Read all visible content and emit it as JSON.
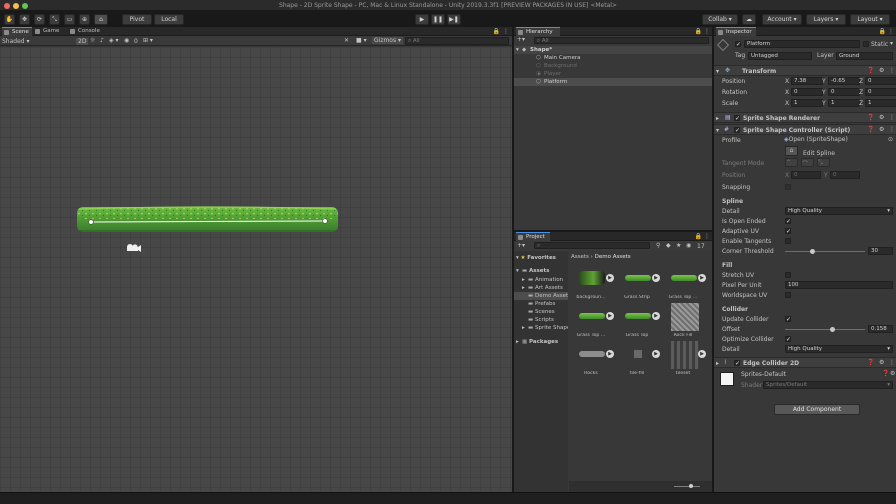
{
  "window": {
    "title": "Shape - 2D Sprite Shape - PC, Mac & Linux Standalone - Unity 2019.3.3f1 [PREVIEW PACKAGES IN USE] <Metal>"
  },
  "toolbar": {
    "pivot": "Pivot",
    "local": "Local",
    "collab": "Collab",
    "account": "Account",
    "layers": "Layers",
    "layout": "Layout"
  },
  "scene": {
    "tabs": [
      "Scene",
      "Game",
      "Console"
    ],
    "shading": "Shaded",
    "mode_2d": "2D",
    "fx_count": "0",
    "gizmos": "Gizmos",
    "search": "All"
  },
  "hierarchy": {
    "tab": "Hierarchy",
    "search": "All",
    "items": [
      {
        "label": "Shape*",
        "depth": 0,
        "active": true,
        "selected": false,
        "root": true
      },
      {
        "label": "Main Camera",
        "depth": 1,
        "active": true,
        "selected": false
      },
      {
        "label": "Background",
        "depth": 1,
        "active": false,
        "selected": false
      },
      {
        "label": "Player",
        "depth": 1,
        "active": false,
        "selected": false
      },
      {
        "label": "Platform",
        "depth": 1,
        "active": true,
        "selected": true
      }
    ]
  },
  "project": {
    "tab": "Project",
    "breadcrumb_root": "Assets",
    "breadcrumb_leaf": "Demo Assets",
    "count": "17",
    "favorites": "Favorites",
    "tree": [
      {
        "label": "Assets",
        "depth": 0
      },
      {
        "label": "Animation",
        "depth": 1
      },
      {
        "label": "Art Assets",
        "depth": 1
      },
      {
        "label": "Demo Assets",
        "depth": 1
      },
      {
        "label": "Prefabs",
        "depth": 1
      },
      {
        "label": "Scenes",
        "depth": 1
      },
      {
        "label": "Scripts",
        "depth": 1
      },
      {
        "label": "Sprite Shape",
        "depth": 1
      },
      {
        "label": "Packages",
        "depth": 0
      }
    ],
    "assets": [
      {
        "label": "backgroun..."
      },
      {
        "label": "Grass Strip"
      },
      {
        "label": "Grass Top ..."
      },
      {
        "label": "Grass Top ..."
      },
      {
        "label": "Grass Top"
      },
      {
        "label": "Rock Fill"
      },
      {
        "label": "Rocks"
      },
      {
        "label": "tile-fill"
      },
      {
        "label": "tileset"
      }
    ]
  },
  "inspector": {
    "tab": "Inspector",
    "name": "Platform",
    "static": "Static",
    "tag_label": "Tag",
    "tag": "Untagged",
    "layer_label": "Layer",
    "layer": "Ground",
    "transform": {
      "title": "Transform",
      "position": {
        "label": "Position",
        "x": "7.38",
        "y": "-0.65",
        "z": "0"
      },
      "rotation": {
        "label": "Rotation",
        "x": "0",
        "y": "0",
        "z": "0"
      },
      "scale": {
        "label": "Scale",
        "x": "1",
        "y": "1",
        "z": "1"
      }
    },
    "renderer_title": "Sprite Shape Renderer",
    "controller": {
      "title": "Sprite Shape Controller (Script)",
      "profile_label": "Profile",
      "profile": "Open (SpriteShape)",
      "edit_spline": "Edit Spline",
      "tangent_mode": "Tangent Mode",
      "position_label": "Position",
      "pos_x": "0",
      "pos_y": "0",
      "snapping": "Snapping",
      "spline_header": "Spline",
      "detail_label": "Detail",
      "detail": "High Quality",
      "is_open_ended": "Is Open Ended",
      "adaptive_uv": "Adaptive UV",
      "enable_tangents": "Enable Tangents",
      "corner_threshold_label": "Corner Threshold",
      "corner_threshold": "30",
      "corner_threshold_fraction": 0.33,
      "fill_header": "Fill",
      "stretch_uv": "Stretch UV",
      "pixel_per_unit_label": "Pixel Per Unit",
      "pixel_per_unit": "100",
      "worldspace_uv": "Worldspace UV",
      "collider_header": "Collider",
      "update_collider": "Update Collider",
      "offset_label": "Offset",
      "offset": "0.158",
      "offset_fraction": 0.6,
      "optimize_collider": "Optimize Collider",
      "collider_detail_label": "Detail",
      "collider_detail": "High Quality"
    },
    "edge_collider_title": "Edge Collider 2D",
    "material_name": "Sprites-Default",
    "shader_label": "Shader",
    "shader": "Sprites/Default",
    "add_component": "Add Component"
  },
  "colors": {
    "accent": "#4a90e2",
    "grass": "#4f9e35",
    "selection": "#2c5d87"
  }
}
